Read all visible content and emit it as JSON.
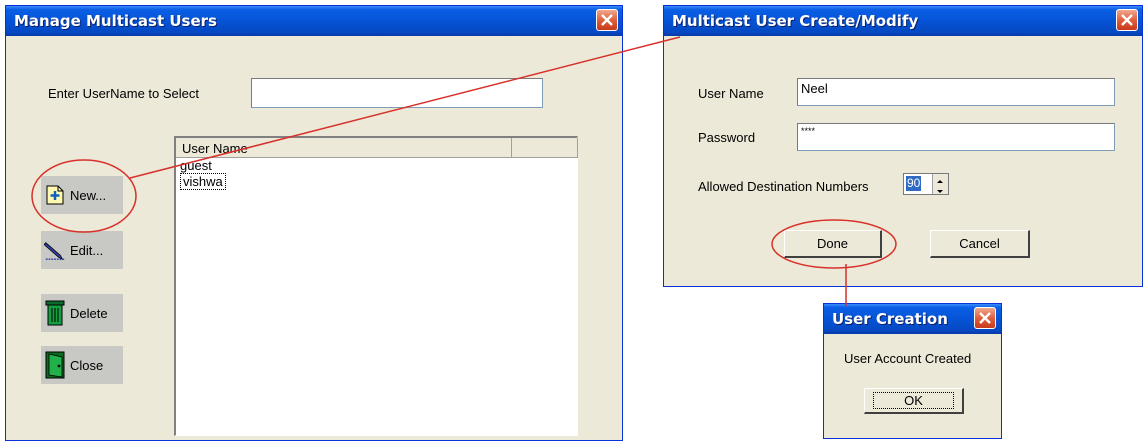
{
  "manage_window": {
    "title": "Manage Multicast Users",
    "select_label": "Enter UserName to Select",
    "select_value": "",
    "list": {
      "header": "User Name",
      "items": [
        "guest",
        "vishwa"
      ]
    },
    "buttons": {
      "new": "New...",
      "edit": "Edit...",
      "delete": "Delete",
      "close": "Close"
    }
  },
  "create_window": {
    "title": "Multicast User Create/Modify",
    "username_label": "User Name",
    "username_value": "Neel",
    "password_label": "Password",
    "password_value": "****",
    "dest_label": "Allowed Destination Numbers",
    "dest_value": "90",
    "done_label": "Done",
    "cancel_label": "Cancel"
  },
  "message_box": {
    "title": "User Creation",
    "message": "User Account Created",
    "ok_label": "OK"
  },
  "colors": {
    "title_bar": "#0653d6",
    "window_bg": "#ece9d8",
    "annotation": "#d8302a",
    "close_button": "#e0603c"
  }
}
